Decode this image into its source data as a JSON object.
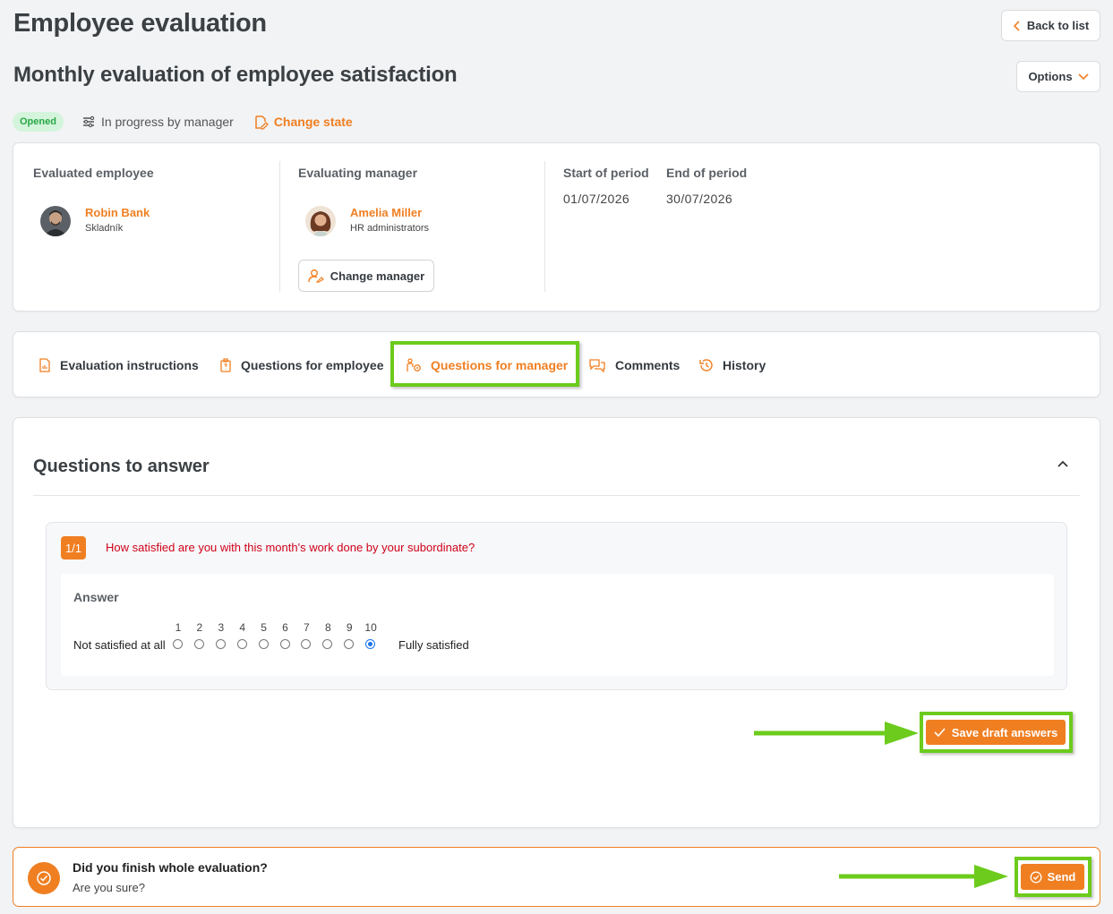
{
  "page": {
    "title": "Employee evaluation",
    "subtitle": "Monthly evaluation of employee satisfaction",
    "back_label": "Back to list",
    "options_label": "Options"
  },
  "status": {
    "badge": "Opened",
    "progress": "In progress by manager",
    "change_state": "Change state"
  },
  "info": {
    "employee_title": "Evaluated employee",
    "employee_name": "Robin Bank",
    "employee_role": "Skladník",
    "manager_title": "Evaluating manager",
    "manager_name": "Amelia Miller",
    "manager_role": "HR administrators",
    "change_manager": "Change manager",
    "start_title": "Start of period",
    "start_value": "01/07/2026",
    "end_title": "End of period",
    "end_value": "30/07/2026"
  },
  "tabs": [
    {
      "label": "Evaluation instructions"
    },
    {
      "label": "Questions for employee"
    },
    {
      "label": "Questions for manager"
    },
    {
      "label": "Comments"
    },
    {
      "label": "History"
    }
  ],
  "active_tab": "Questions for manager",
  "questions": {
    "title": "Questions to answer",
    "counter": "1/1",
    "text": "How satisfied are you with this month's work done by your subordinate?",
    "answer_label": "Answer",
    "scale": [
      "1",
      "2",
      "3",
      "4",
      "5",
      "6",
      "7",
      "8",
      "9",
      "10"
    ],
    "selected": "10",
    "min_label": "Not satisfied at all",
    "max_label": "Fully satisfied",
    "save_draft": "Save draft answers"
  },
  "finish": {
    "title": "Did you finish whole evaluation?",
    "subtitle": "Are you sure?",
    "send": "Send"
  },
  "colors": {
    "accent": "#f07f22",
    "highlight": "#6ccb1c",
    "badge_bg": "#d4f5dc",
    "badge_text": "#28a745",
    "question_text": "#d0021b"
  },
  "icons": [
    "chevron-left-icon",
    "chevron-down-icon",
    "sliders-icon",
    "edit-state-icon",
    "user-edit-icon",
    "document-icon",
    "clipboard-icon",
    "user-settings-icon",
    "chat-icon",
    "history-icon",
    "chevron-up-icon",
    "check-icon",
    "check-circle-icon"
  ]
}
